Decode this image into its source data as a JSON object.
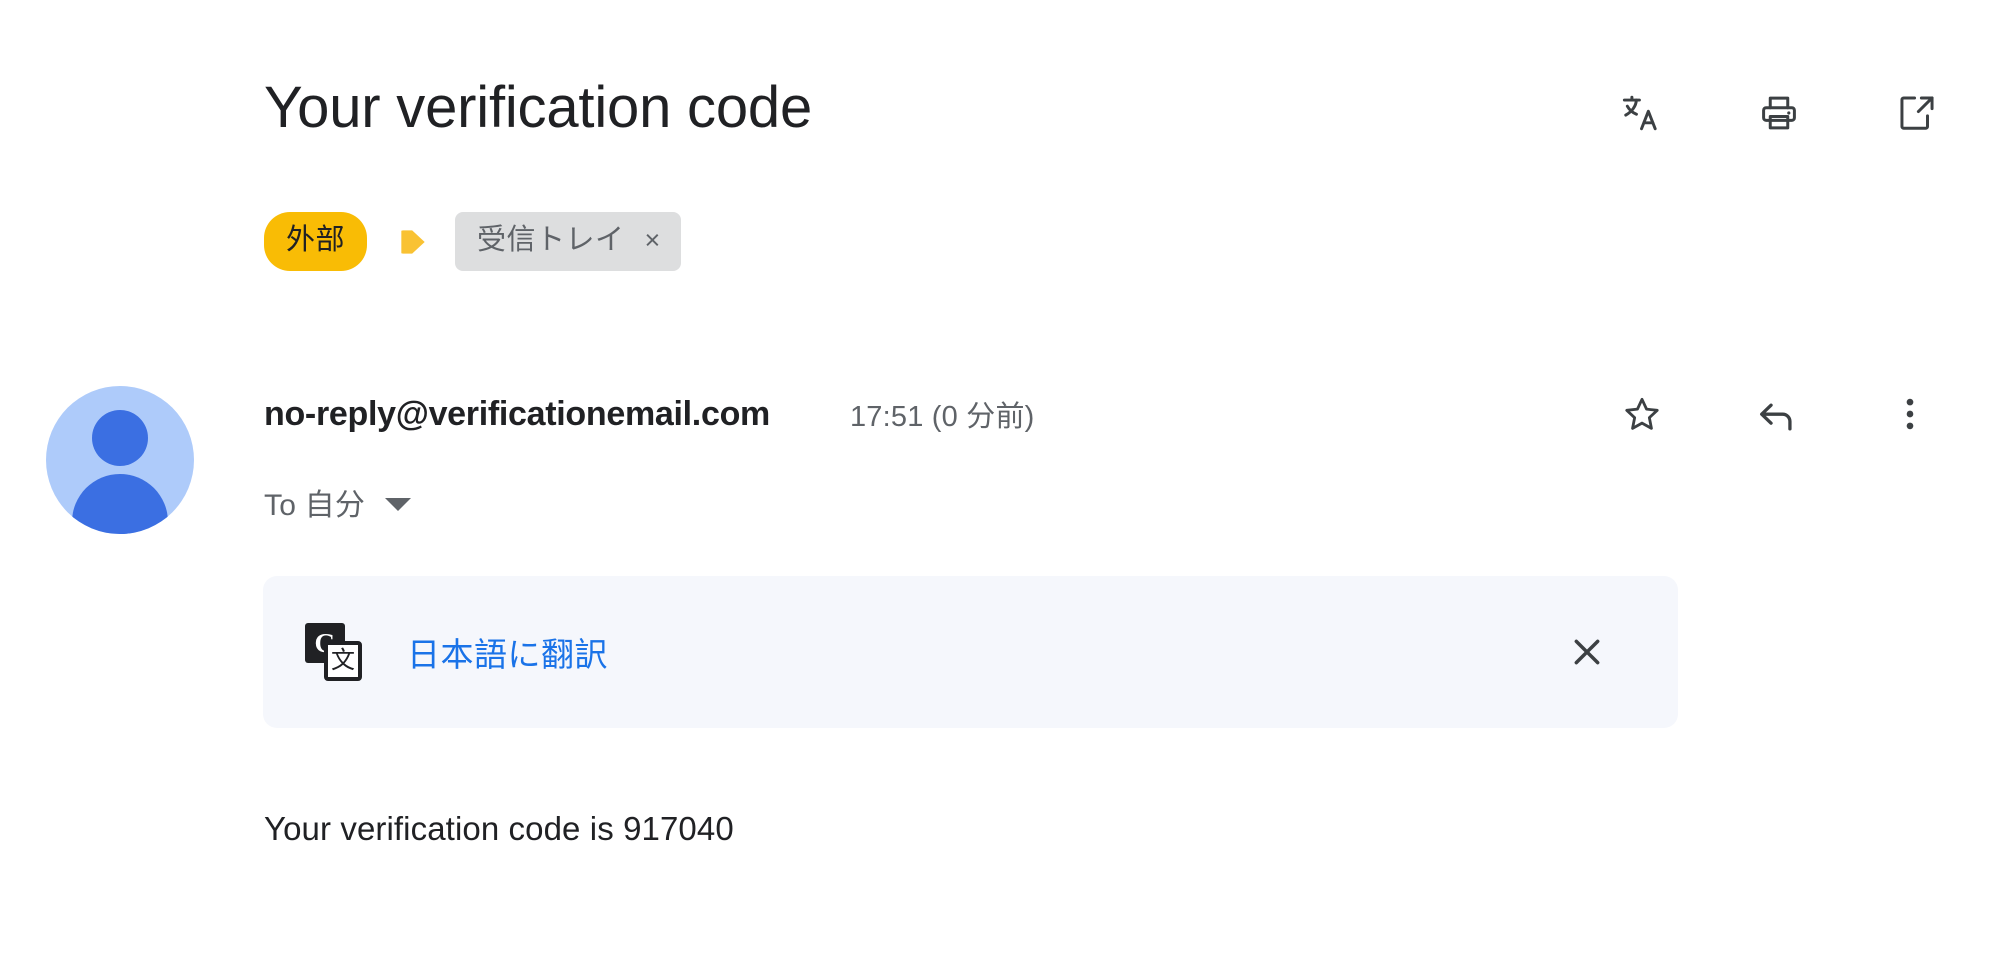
{
  "header": {
    "subject": "Your verification code",
    "actions": [
      {
        "name": "translate-icon",
        "label": "文A"
      },
      {
        "name": "print-icon",
        "label": "Print"
      },
      {
        "name": "open-in-new-icon",
        "label": "Open in new window"
      }
    ]
  },
  "labels": {
    "external_badge": "外部",
    "inbox_chip": "受信トレイ",
    "inbox_chip_remove": "×",
    "badge_color": "#F9BC05",
    "chevron_color": "#F9C233",
    "chip_bg_color": "#DDDEDF",
    "chip_text_color": "#5F6368"
  },
  "message": {
    "sender": "no-reply@verificationemail.com",
    "timestamp": "17:51 (0 分前)",
    "to_label": "To 自分",
    "actions": [
      {
        "name": "star-icon",
        "label": "Star"
      },
      {
        "name": "reply-icon",
        "label": "Reply"
      },
      {
        "name": "more-options-icon",
        "label": "More"
      }
    ],
    "avatar": {
      "bg_color": "#AECBFA",
      "fg_color": "#3B6FE2"
    }
  },
  "translate_banner": {
    "link_text": "日本語に翻訳",
    "link_color": "#1A73E8",
    "background_color": "#F5F7FC",
    "icon_g": "G",
    "icon_char": "文",
    "close_label": "✕"
  },
  "body": {
    "text": "Your verification code is 917040"
  }
}
